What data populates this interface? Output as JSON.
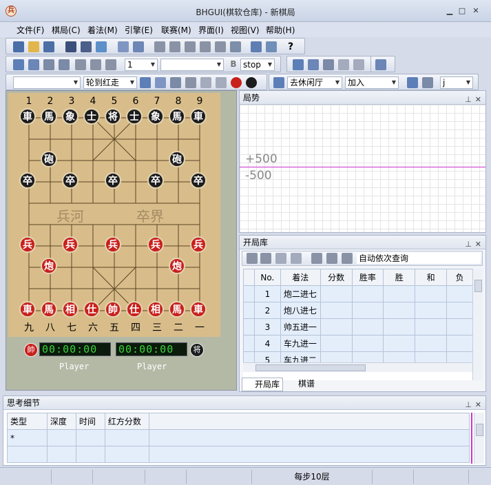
{
  "window": {
    "title": "BHGUI(棋软仓库) - 新棋局",
    "app_icon_char": "兵"
  },
  "menu": [
    "文件(F)",
    "棋局(C)",
    "着法(M)",
    "引擎(E)",
    "联赛(M)",
    "界面(I)",
    "视图(V)",
    "帮助(H)"
  ],
  "toolbar3": {
    "level_value": "1",
    "stop_label": "stop"
  },
  "toolbar4": {
    "turn_text": "轮到红走",
    "rest_text": "去休闲厅",
    "join_text": "加入",
    "j_value": "j"
  },
  "board": {
    "top_files": [
      "1",
      "2",
      "3",
      "4",
      "5",
      "6",
      "7",
      "8",
      "9"
    ],
    "bottom_files": [
      "九",
      "八",
      "七",
      "六",
      "五",
      "四",
      "三",
      "二",
      "一"
    ],
    "river_left": "兵河",
    "river_right": "卒界",
    "black_back": [
      "車",
      "馬",
      "象",
      "士",
      "将",
      "士",
      "象",
      "馬",
      "車"
    ],
    "black_cannon": "砲",
    "black_pawn": "卒",
    "red_back": [
      "車",
      "馬",
      "相",
      "仕",
      "帥",
      "仕",
      "相",
      "馬",
      "車"
    ],
    "red_cannon": "炮",
    "red_pawn": "兵"
  },
  "clocks": {
    "red_icon": "帥",
    "black_icon": "将",
    "red_time": "00:00:00",
    "black_time": "00:00:00",
    "red_player": "Player",
    "black_player": "Player"
  },
  "trend": {
    "title": "局势",
    "upper_label": "+500",
    "lower_label": "-500",
    "pin": "⊥",
    "close": "✕"
  },
  "opening": {
    "title": "开局库",
    "auto_query": "自动依次查询",
    "headers": [
      "No.",
      "着法",
      "分数",
      "胜率",
      "胜",
      "和",
      "负"
    ],
    "rows": [
      {
        "no": "1",
        "move": "炮二进七"
      },
      {
        "no": "2",
        "move": "炮八进七"
      },
      {
        "no": "3",
        "move": "帅五进一"
      },
      {
        "no": "4",
        "move": "车九进一"
      },
      {
        "no": "5",
        "move": "车九进二"
      }
    ],
    "tabs": [
      "开局库",
      "棋谱"
    ]
  },
  "thinking": {
    "title": "思考细节",
    "headers": [
      "类型",
      "深度",
      "时间",
      "红方分数"
    ],
    "row_marker": "*"
  },
  "status": {
    "depth_text": "每步10层"
  },
  "colors": {
    "accent": "#c8201c",
    "trend_line": "#cc33cc",
    "led": "#3cd43c"
  }
}
